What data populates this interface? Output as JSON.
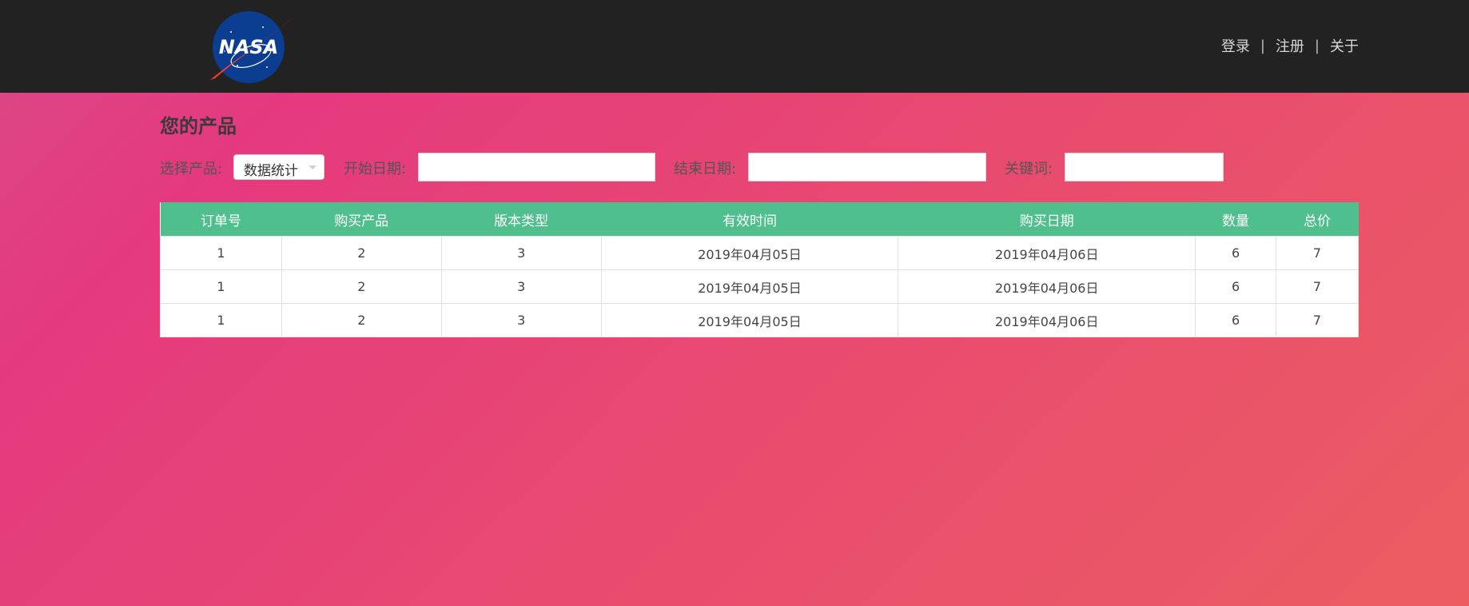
{
  "header": {
    "logo_text": "NASA",
    "nav": [
      "登录",
      "注册",
      "关于"
    ],
    "separator": "|"
  },
  "page": {
    "title": "您的产品"
  },
  "filters": {
    "product_label": "选择产品:",
    "product_value": "数据统计",
    "start_label": "开始日期:",
    "start_value": "",
    "end_label": "结束日期:",
    "end_value": "",
    "keyword_label": "关键词:",
    "keyword_value": ""
  },
  "table": {
    "columns": [
      "订单号",
      "购买产品",
      "版本类型",
      "有效时间",
      "购买日期",
      "数量",
      "总价"
    ],
    "rows": [
      [
        "1",
        "2",
        "3",
        "2019年04月05日",
        "2019年04月06日",
        "6",
        "7"
      ],
      [
        "1",
        "2",
        "3",
        "2019年04月05日",
        "2019年04月06日",
        "6",
        "7"
      ],
      [
        "1",
        "2",
        "3",
        "2019年04月05日",
        "2019年04月06日",
        "6",
        "7"
      ]
    ]
  },
  "colors": {
    "topbar": "#222222",
    "table_header": "#4fbf8d",
    "background_start": "#e5397f",
    "background_end": "#ec5d62"
  }
}
